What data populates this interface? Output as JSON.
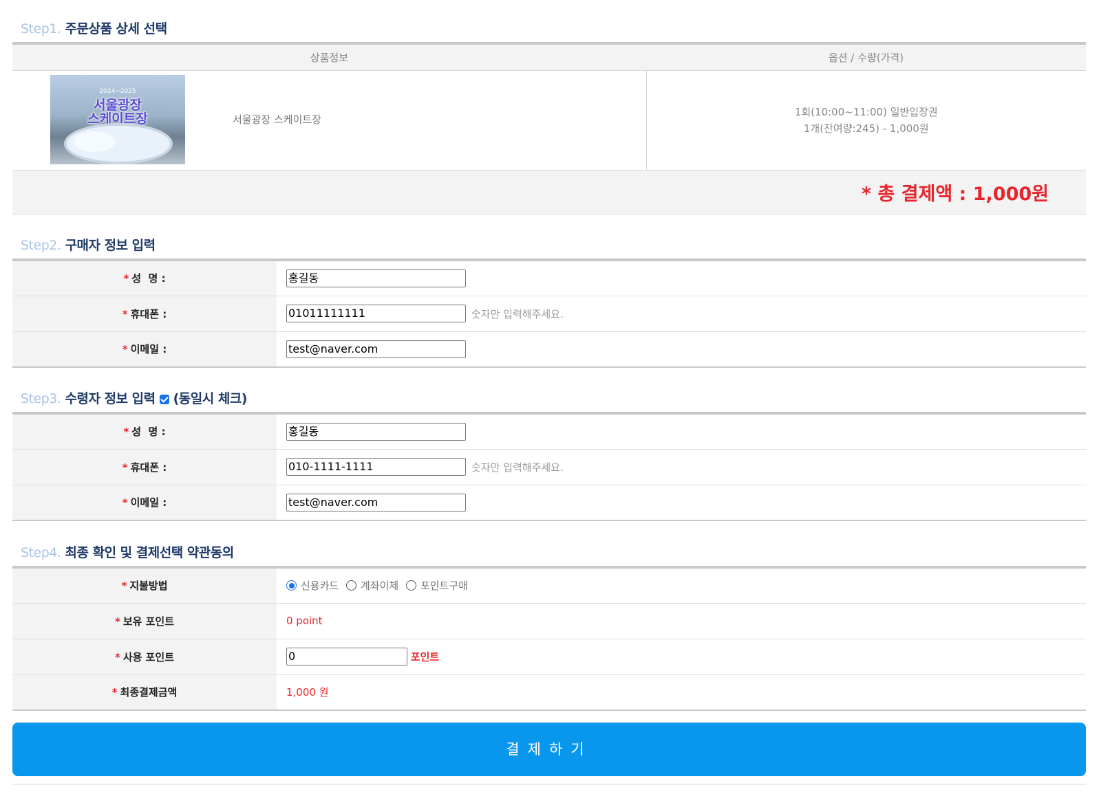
{
  "step1": {
    "num": "Step1.",
    "title": "주문상품 상세 선택",
    "col_product": "상품정보",
    "col_option": "옵션 / 수량(가격)",
    "thumb_line1": "서울광장",
    "thumb_line2": "스케이트장",
    "product_name": "서울광장 스케이트장",
    "option_line1": "1회(10:00~11:00) 일반입장권",
    "option_line2": "1개(잔여량:245) - 1,000원",
    "total_label": "* 총 결제액 : 1,000원"
  },
  "step2": {
    "num": "Step2.",
    "title": "구매자 정보 입력",
    "name_label": "성  명 :",
    "phone_label": "휴대폰 :",
    "email_label": "이메일 :",
    "name_value": "홍길동",
    "phone_value": "01011111111",
    "email_value": "test@naver.com",
    "phone_hint": "숫자만 입력해주세요."
  },
  "step3": {
    "num": "Step3.",
    "title": "수령자 정보 입력",
    "same_check_label": "(동일시 체크)",
    "same_checked": true,
    "name_label": "성  명 :",
    "phone_label": "휴대폰 :",
    "email_label": "이메일 :",
    "name_value": "홍길동",
    "phone_value": "010-1111-1111",
    "email_value": "test@naver.com",
    "phone_hint": "숫자만 입력해주세요."
  },
  "step4": {
    "num": "Step4.",
    "title": "최종 확인 및 결제선택 약관동의",
    "pay_method_label": "지불방법",
    "pay_options": [
      "신용카드",
      "계좌이체",
      "포인트구매"
    ],
    "pay_selected": "신용카드",
    "held_points_label": "보유 포인트",
    "held_points_value": "0 point",
    "use_points_label": "사용 포인트",
    "use_points_value": "0",
    "use_points_unit": "포인트",
    "final_amount_label": "최종결제금액",
    "final_amount_value": "1,000 원"
  },
  "pay_button": "결제하기",
  "colors": {
    "accent": "#0997ee",
    "required": "#e8252c",
    "title": "#1f3a68",
    "step_num": "#a9c3e6"
  }
}
